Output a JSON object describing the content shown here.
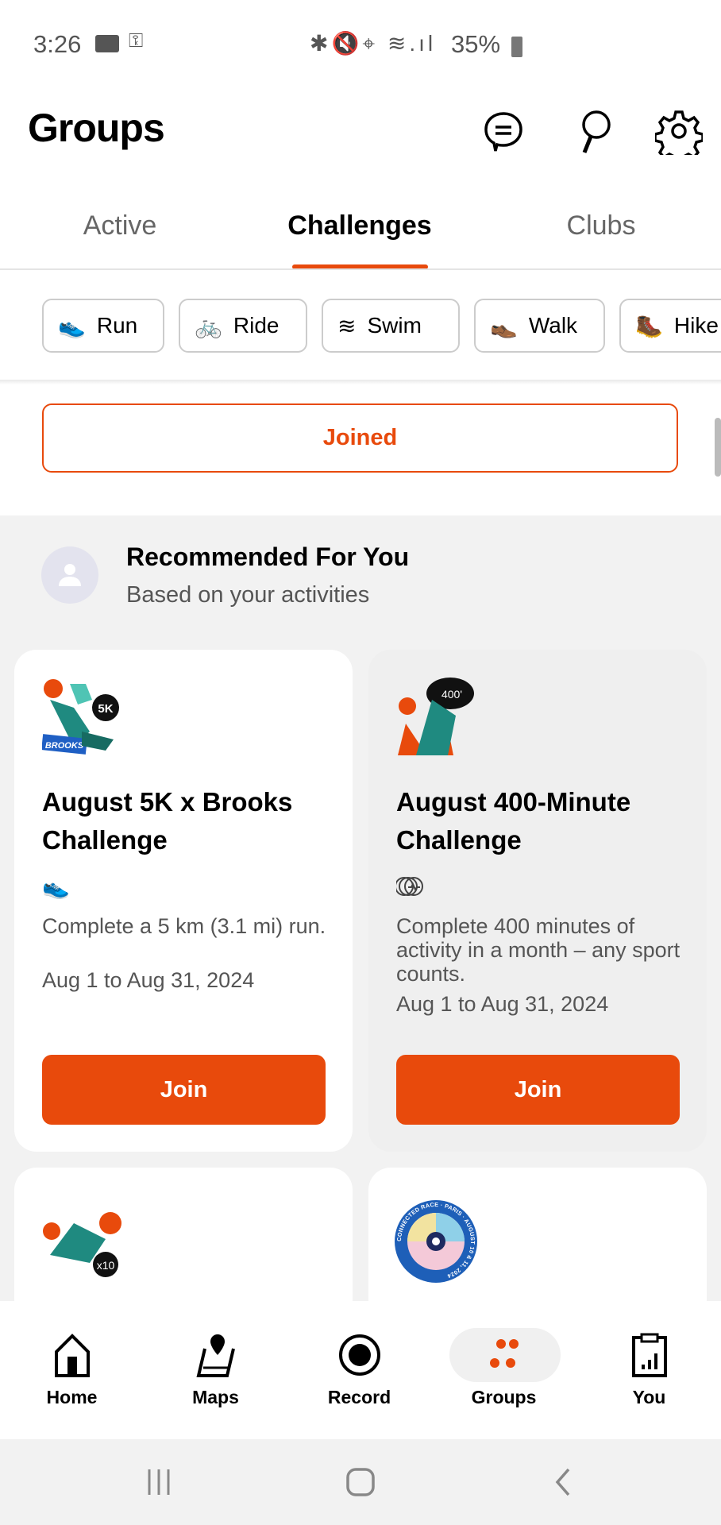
{
  "status_bar": {
    "time": "3:26",
    "battery": "35%",
    "icons": [
      "video-icon",
      "key-icon",
      "bluetooth-icon",
      "mute-icon",
      "location-icon",
      "wifi-icon",
      "signal-icon",
      "battery-icon"
    ]
  },
  "header": {
    "title": "Groups",
    "icons": [
      "chat-icon",
      "search-icon",
      "gear-icon"
    ]
  },
  "tabs": [
    {
      "label": "Active"
    },
    {
      "label": "Challenges",
      "active": true
    },
    {
      "label": "Clubs"
    }
  ],
  "filters": [
    {
      "label": "Run",
      "icon": "shoe-icon"
    },
    {
      "label": "Ride",
      "icon": "bike-icon"
    },
    {
      "label": "Swim",
      "icon": "waves-icon"
    },
    {
      "label": "Walk",
      "icon": "walk-shoe-icon"
    },
    {
      "label": "Hike",
      "icon": "hike-boot-icon"
    }
  ],
  "joined_label": "Joined",
  "recommended": {
    "title": "Recommended For You",
    "subtitle": "Based on your activities"
  },
  "cards": [
    {
      "title": "August 5K x Brooks Challenge",
      "description": "Complete a 5 km (3.1 mi) run.",
      "dates": "Aug 1 to Aug 31, 2024",
      "join_label": "Join",
      "badge_text": "5K",
      "badge_brand": "BROOKS",
      "sport_icon": "shoe-icon"
    },
    {
      "title": "August 400-Minute Challenge",
      "description": "Complete 400 minutes of activity in a month – any sport counts.",
      "dates": "Aug 1 to Aug 31, 2024",
      "join_label": "Join",
      "badge_text": "400'",
      "sport_icon": "multi-sport-icon"
    }
  ],
  "more_badges": [
    {
      "badge_text": "x10"
    },
    {
      "badge_text": "CONNECTED RACE · PARIS · AUGUST 10 & 11, 2024"
    }
  ],
  "bottom_nav": [
    {
      "label": "Home",
      "icon": "home-icon"
    },
    {
      "label": "Maps",
      "icon": "maps-icon"
    },
    {
      "label": "Record",
      "icon": "record-icon"
    },
    {
      "label": "Groups",
      "icon": "groups-icon",
      "active": true
    },
    {
      "label": "You",
      "icon": "clipboard-chart-icon"
    }
  ],
  "colors": {
    "accent": "#e84a0c",
    "teal": "#1f8a80"
  }
}
